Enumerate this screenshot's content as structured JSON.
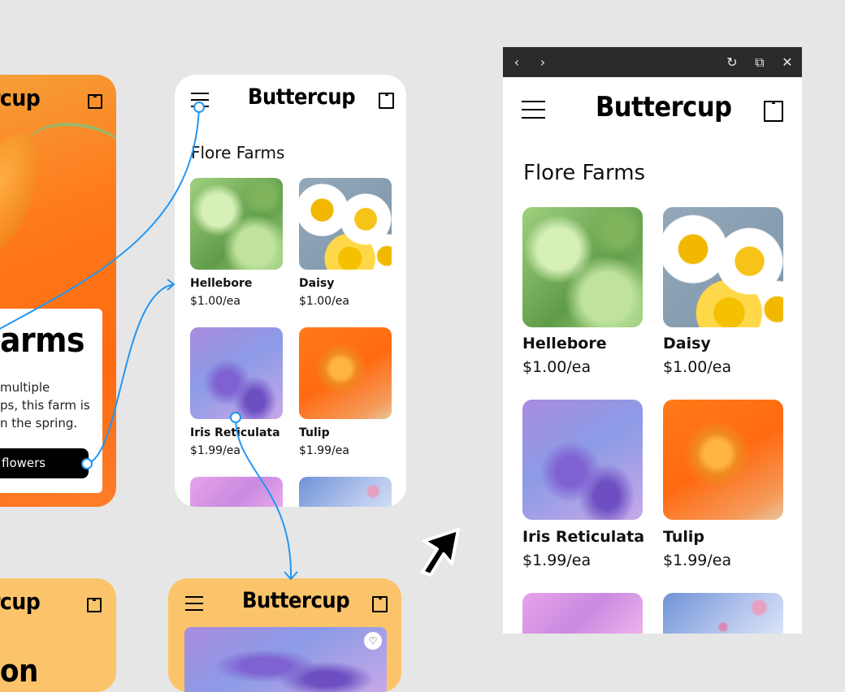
{
  "brand": "Buttercup",
  "section_title": "Flore Farms",
  "products": [
    {
      "name": "Hellebore",
      "price": "$1.00/ea",
      "image": "hellebore"
    },
    {
      "name": "Daisy",
      "price": "$1.00/ea",
      "image": "daisy"
    },
    {
      "name": "Iris Reticulata",
      "price": "$1.99/ea",
      "image": "iris"
    },
    {
      "name": "Tulip",
      "price": "$1.99/ea",
      "image": "tulip"
    },
    {
      "image": "pink-flower"
    },
    {
      "image": "sky-flower"
    }
  ],
  "left_screen": {
    "brand_partial": "rcup",
    "heading_partial": "arms",
    "body_lines": [
      "multiple",
      "ps, this farm is",
      "n the spring."
    ],
    "button_partial": "flowers"
  },
  "bottom_left": {
    "brand_partial": "rcup",
    "heading_partial": "on"
  },
  "browser": {
    "controls": [
      "back-icon",
      "forward-icon",
      "reload-icon",
      "open-external-icon",
      "close-icon"
    ]
  },
  "colors": {
    "canvas": "#e6e6e6",
    "accent_orange": "#ff6a10",
    "screen_yellow": "#fcc46a",
    "flow_blue": "#2196f3",
    "browser_bar": "#2b2b2b"
  }
}
